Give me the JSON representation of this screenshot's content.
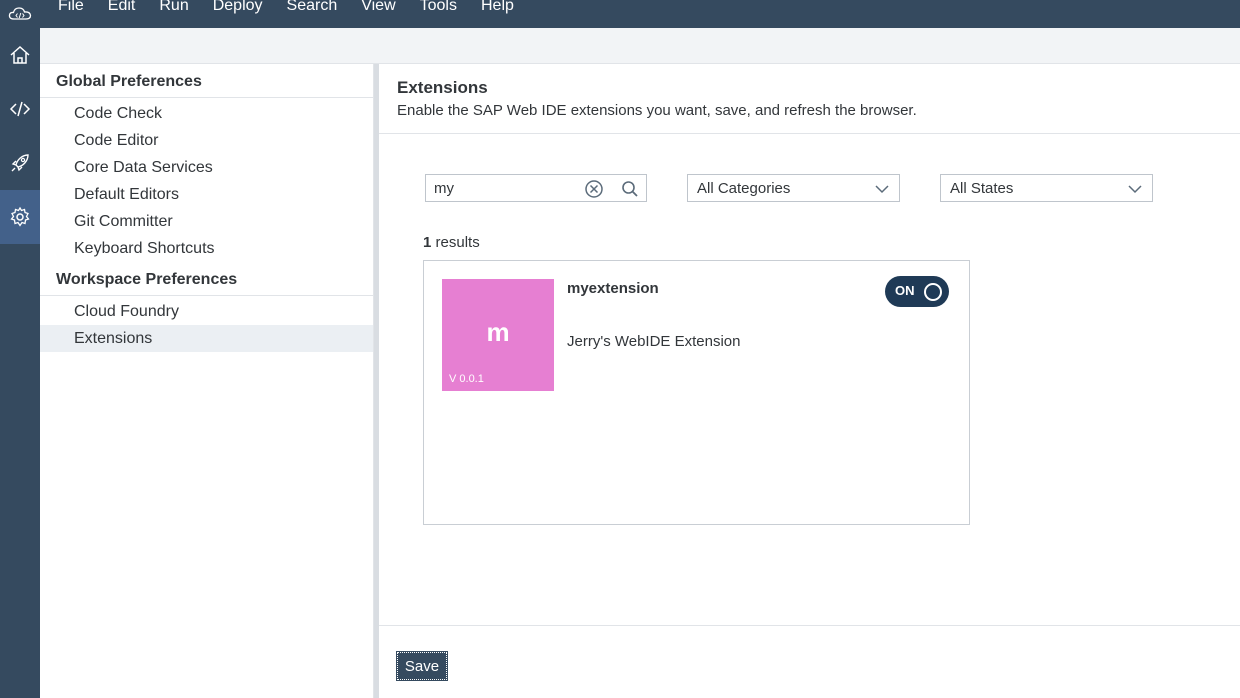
{
  "menu": [
    "File",
    "Edit",
    "Run",
    "Deploy",
    "Search",
    "View",
    "Tools",
    "Help"
  ],
  "activity_icons": [
    "home-icon",
    "code-icon",
    "rocket-icon",
    "gear-icon"
  ],
  "prefs": {
    "global_title": "Global Preferences",
    "global_items": [
      "Code Check",
      "Code Editor",
      "Core Data Services",
      "Default Editors",
      "Git Committer",
      "Keyboard Shortcuts"
    ],
    "workspace_title": "Workspace Preferences",
    "workspace_items": [
      "Cloud Foundry",
      "Extensions"
    ],
    "selected": "Extensions"
  },
  "main": {
    "title": "Extensions",
    "description": "Enable the SAP Web IDE extensions you want, save, and refresh the browser."
  },
  "filters": {
    "search_value": "my",
    "category": "All Categories",
    "state": "All States"
  },
  "results": {
    "count": "1",
    "label": "results"
  },
  "extension": {
    "tile_letter": "m",
    "version": "V 0.0.1",
    "name": "myextension",
    "description": "Jerry's WebIDE Extension",
    "toggle_label": "ON",
    "tile_color": "#e67fd2"
  },
  "footer": {
    "save_label": "Save"
  },
  "colors": {
    "shell": "#354a5f",
    "toggle_on": "#1f3a56"
  }
}
